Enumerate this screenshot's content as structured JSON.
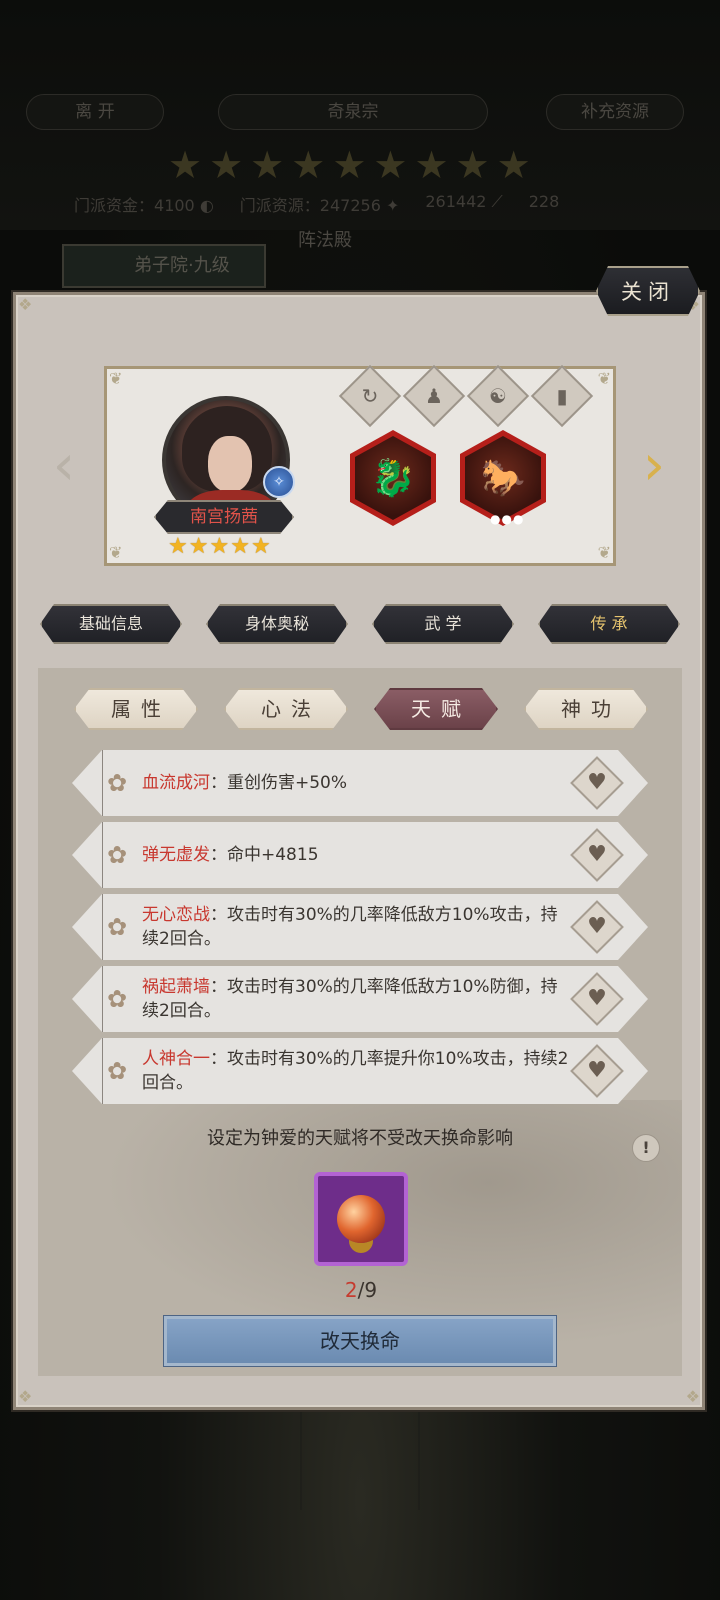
{
  "background": {
    "leave_label": "离 开",
    "sect_name": "奇泉宗",
    "supply_label": "补充资源",
    "stars_count": 9,
    "resources": [
      {
        "label": "门派资金：",
        "value": "4100"
      },
      {
        "label": "门派资源：",
        "value": "247256"
      },
      {
        "label": "",
        "value": "261442"
      },
      {
        "label": "",
        "value": "228"
      }
    ],
    "sub_title": "阵法殿",
    "building_tab": "弟子院·九级"
  },
  "close_label": "关闭",
  "hero": {
    "name": "南宫扬茜",
    "stars": 5,
    "skill_icons": [
      "cycle-icon",
      "person-icon",
      "yin-yang-icon",
      "book-icon"
    ],
    "equipment": [
      "dragon-scroll",
      "war-horse"
    ]
  },
  "main_tabs": [
    {
      "label": "基础信息",
      "active": false
    },
    {
      "label": "身体奥秘",
      "active": false
    },
    {
      "label": "武 学",
      "active": false
    },
    {
      "label": "传 承",
      "active": true
    }
  ],
  "sub_tabs": [
    {
      "label": "属性",
      "active": false
    },
    {
      "label": "心法",
      "active": false
    },
    {
      "label": "天赋",
      "active": true
    },
    {
      "label": "神功",
      "active": false
    }
  ],
  "talents": [
    {
      "name": "血流成河",
      "desc": "：重创伤害+50%"
    },
    {
      "name": "弹无虚发",
      "desc": "：命中+4815"
    },
    {
      "name": "无心恋战",
      "desc": "：攻击时有30%的几率降低敌方10%攻击，持续2回合。"
    },
    {
      "name": "祸起萧墙",
      "desc": "：攻击时有30%的几率降低敌方10%防御，持续2回合。"
    },
    {
      "name": "人神合一",
      "desc": "：攻击时有30%的几率提升你10%攻击，持续2回合。"
    }
  ],
  "notice": "设定为钟爱的天赋将不受改天换命影响",
  "item": {
    "current": "2",
    "total": "/9"
  },
  "action_label": "改天换命",
  "colors": {
    "talent_name": "#c8382f",
    "action_button": "#7b98bd",
    "item_frame": "#b363d3"
  }
}
